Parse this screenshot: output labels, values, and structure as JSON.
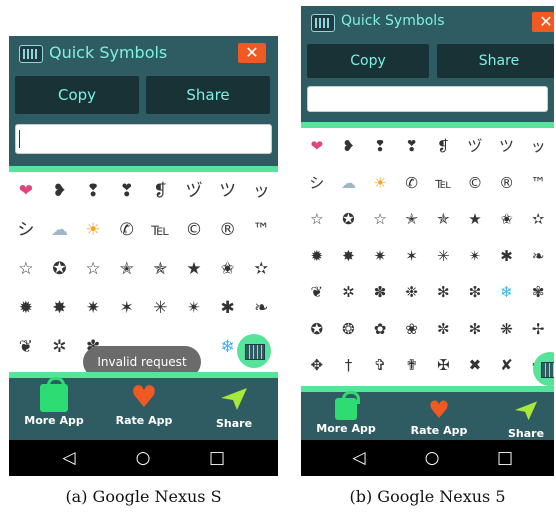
{
  "app": {
    "title": "Quick Symbols",
    "close_icon": "✕"
  },
  "buttons": {
    "copy": "Copy",
    "share": "Share"
  },
  "input": {
    "value": ""
  },
  "toast": "Invalid request",
  "bottom_nav": {
    "more_app": "More App",
    "rate_app": "Rate App",
    "share": "Share"
  },
  "system_nav": {
    "back": "◁",
    "home": "○",
    "recent": "□"
  },
  "captions": {
    "a": "(a) Google Nexus S",
    "b": "(b) Google Nexus 5"
  },
  "colors": {
    "header": "#2f5c62",
    "accent_green": "#56e39a",
    "title_text": "#7df0e6",
    "close_orange": "#f05a22"
  },
  "symbols_a": [
    [
      "❤",
      "❥",
      "❢",
      "❣",
      "❡",
      "ヅ",
      "ツ",
      "ッ"
    ],
    [
      "シ",
      "☁",
      "☀",
      "✆",
      "℡",
      "©",
      "®",
      "™"
    ],
    [
      "☆",
      "✪",
      "☆",
      "✭",
      "✯",
      "★",
      "✬",
      "✫"
    ],
    [
      "✹",
      "✸",
      "✷",
      "✶",
      "✳",
      "✴",
      "✱",
      "❧"
    ],
    [
      "❦",
      "✲",
      "✽",
      "",
      "",
      "",
      "❄",
      ""
    ]
  ],
  "symbols_b": [
    [
      "❤",
      "❥",
      "❢",
      "❣",
      "❡",
      "ヅ",
      "ツ",
      "ッ"
    ],
    [
      "シ",
      "☁",
      "☀",
      "✆",
      "℡",
      "©",
      "®",
      "™"
    ],
    [
      "☆",
      "✪",
      "☆",
      "✭",
      "✯",
      "★",
      "✬",
      "✫"
    ],
    [
      "✹",
      "✸",
      "✷",
      "✶",
      "✳",
      "✴",
      "✱",
      "❧"
    ],
    [
      "❦",
      "✲",
      "✽",
      "❉",
      "✻",
      "❇",
      "❄",
      "✾"
    ],
    [
      "✪",
      "❂",
      "✿",
      "❀",
      "✼",
      "✻",
      "❋",
      "✢"
    ],
    [
      "✥",
      "†",
      "✞",
      "✟",
      "✠",
      "✖",
      "✘",
      "✚"
    ]
  ]
}
